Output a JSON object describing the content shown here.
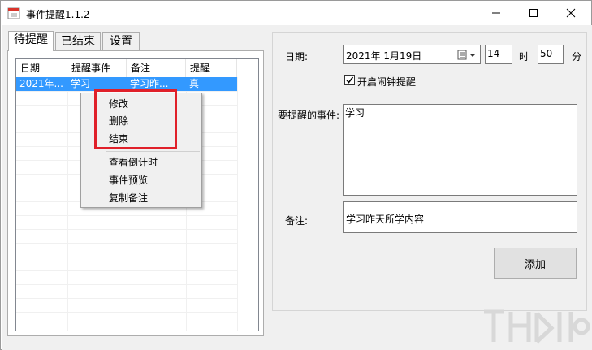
{
  "window": {
    "title": "事件提醒1.1.2",
    "icons": {
      "app": "calendar-icon",
      "minimize": "minimize-icon",
      "maximize": "maximize-icon",
      "close": "close-icon"
    }
  },
  "tabs": [
    {
      "label": "待提醒",
      "active": true
    },
    {
      "label": "已结束",
      "active": false
    },
    {
      "label": "设置",
      "active": false
    }
  ],
  "list": {
    "columns": [
      "日期",
      "提醒事件",
      "备注",
      "提醒"
    ],
    "rows": [
      {
        "date": "2021年...",
        "event": "学习",
        "note": "学习昨...",
        "remind": "真"
      }
    ]
  },
  "context_menu": {
    "items": [
      "修改",
      "删除",
      "结束",
      "查看倒计时",
      "事件预览",
      "复制备注"
    ]
  },
  "form": {
    "date_label": "日期:",
    "date_value": "2021年  1月19日",
    "hour_value": "14",
    "hour_unit": "时",
    "minute_value": "50",
    "minute_unit": "分",
    "alarm_label": "开启闹钟提醒",
    "alarm_checked": true,
    "event_label": "要提醒的事件:",
    "event_value": "学习",
    "note_label": "备注:",
    "note_value": "学习昨天所学内容",
    "add_button": "添加"
  },
  "colors": {
    "selection": "#3399ff",
    "highlight_box": "#e0202a"
  }
}
